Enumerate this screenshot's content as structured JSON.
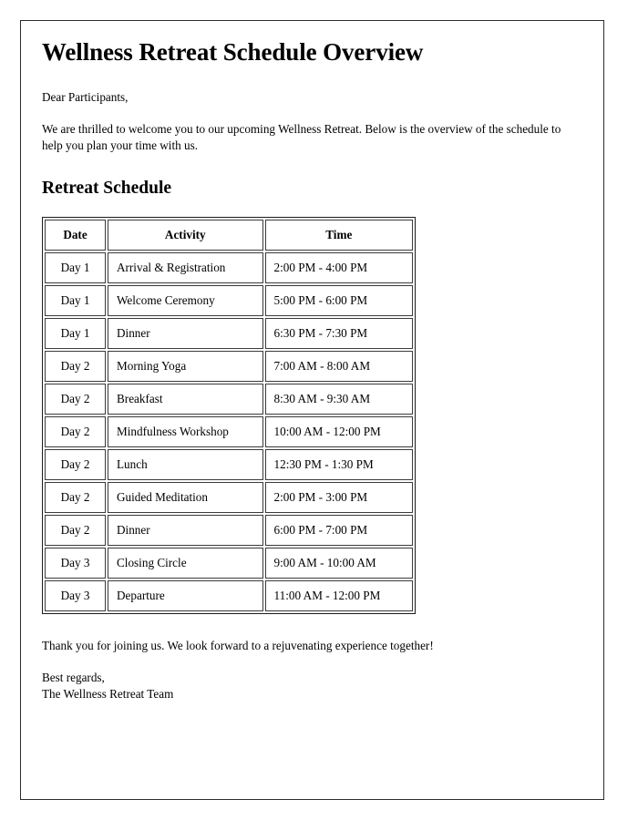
{
  "document": {
    "title": "Wellness Retreat Schedule Overview",
    "salutation": "Dear Participants,",
    "intro_paragraph": "We are thrilled to welcome you to our upcoming Wellness Retreat. Below is the overview of the schedule to help you plan your time with us.",
    "section_heading": "Retreat Schedule",
    "closing_paragraph": "Thank you for joining us. We look forward to a rejuvenating experience together!",
    "signature": {
      "closing": "Best regards,",
      "sender": "The Wellness Retreat Team"
    }
  },
  "schedule_table": {
    "columns": [
      "Date",
      "Activity",
      "Time"
    ],
    "rows": [
      {
        "date": "Day 1",
        "activity": "Arrival & Registration",
        "time": "2:00 PM - 4:00 PM"
      },
      {
        "date": "Day 1",
        "activity": "Welcome Ceremony",
        "time": "5:00 PM - 6:00 PM"
      },
      {
        "date": "Day 1",
        "activity": "Dinner",
        "time": "6:30 PM - 7:30 PM"
      },
      {
        "date": "Day 2",
        "activity": "Morning Yoga",
        "time": "7:00 AM - 8:00 AM"
      },
      {
        "date": "Day 2",
        "activity": "Breakfast",
        "time": "8:30 AM - 9:30 AM"
      },
      {
        "date": "Day 2",
        "activity": "Mindfulness Workshop",
        "time": "10:00 AM - 12:00 PM"
      },
      {
        "date": "Day 2",
        "activity": "Lunch",
        "time": "12:30 PM - 1:30 PM"
      },
      {
        "date": "Day 2",
        "activity": "Guided Meditation",
        "time": "2:00 PM - 3:00 PM"
      },
      {
        "date": "Day 2",
        "activity": "Dinner",
        "time": "6:00 PM - 7:00 PM"
      },
      {
        "date": "Day 3",
        "activity": "Closing Circle",
        "time": "9:00 AM - 10:00 AM"
      },
      {
        "date": "Day 3",
        "activity": "Departure",
        "time": "11:00 AM - 12:00 PM"
      }
    ]
  },
  "colors": {
    "page_background": "#ffffff",
    "text": "#000000",
    "page_border": "#2b2b2e",
    "table_border": "#3a3a3a"
  }
}
